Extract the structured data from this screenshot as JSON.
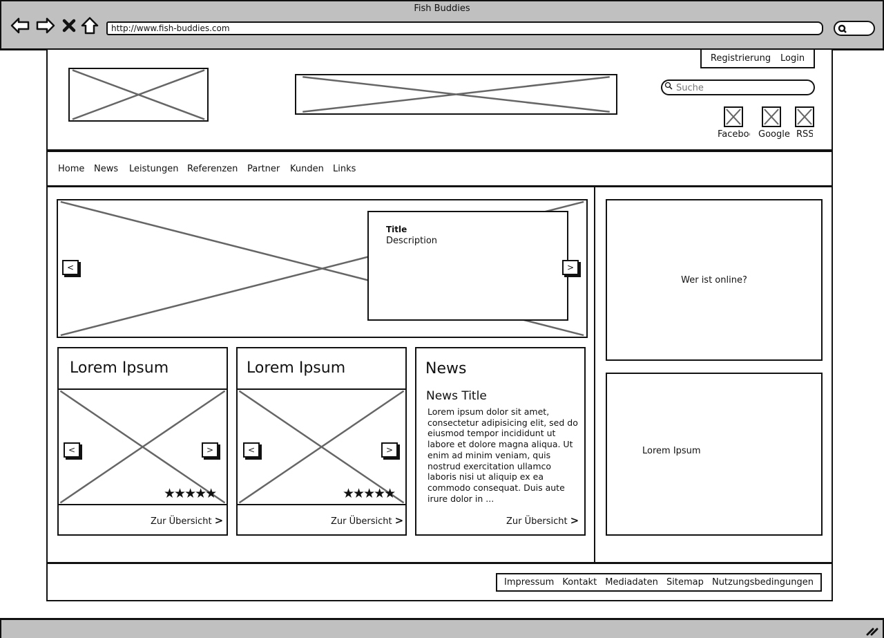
{
  "browser": {
    "window_title": "Fish Buddies",
    "url": "http://www.fish-buddies.com",
    "nav_icons": [
      "back-icon",
      "forward-icon",
      "stop-icon",
      "home-icon"
    ]
  },
  "header": {
    "auth": {
      "register": "Registrierung",
      "login": "Login"
    },
    "search": {
      "placeholder": "Suche",
      "value": ""
    },
    "social": [
      {
        "label": "Faceboo",
        "icon": "facebook-icon"
      },
      {
        "label": "Google",
        "icon": "google-icon"
      },
      {
        "label": "RSS",
        "icon": "rss-icon"
      }
    ]
  },
  "nav": {
    "items": [
      "Home",
      "News",
      "Leistungen",
      "Referenzen",
      "Partner",
      "Kunden",
      "Links"
    ]
  },
  "carousel": {
    "prev": "<",
    "next": ">",
    "caption_title": "Title",
    "caption_description": "Description"
  },
  "cards": [
    {
      "title": "Lorem Ipsum",
      "prev": "<",
      "next": ">",
      "rating": 5,
      "rating_max": 5,
      "stars": "★★★★★",
      "link": "Zur Übersicht",
      "link_arrow": ">"
    },
    {
      "title": "Lorem Ipsum",
      "prev": "<",
      "next": ">",
      "rating": 5,
      "rating_max": 5,
      "stars": "★★★★★",
      "link": "Zur Übersicht",
      "link_arrow": ">"
    }
  ],
  "news": {
    "heading": "News",
    "title": "News Title",
    "body": "Lorem ipsum dolor sit amet, consectetur adipisicing elit, sed do eiusmod tempor incididunt ut labore et dolore magna aliqua. Ut enim ad minim veniam, quis nostrud exercitation ullamco laboris nisi ut aliquip ex ea commodo consequat. Duis aute irure dolor in ...",
    "link": "Zur Übersicht",
    "link_arrow": ">"
  },
  "sidebar": {
    "online_widget": "Wer ist online?",
    "lorem_widget": "Lorem Ipsum"
  },
  "footer": {
    "links": [
      "Impressum",
      "Kontakt",
      "Mediadaten",
      "Sitemap",
      "Nutzungsbedingungen"
    ]
  }
}
